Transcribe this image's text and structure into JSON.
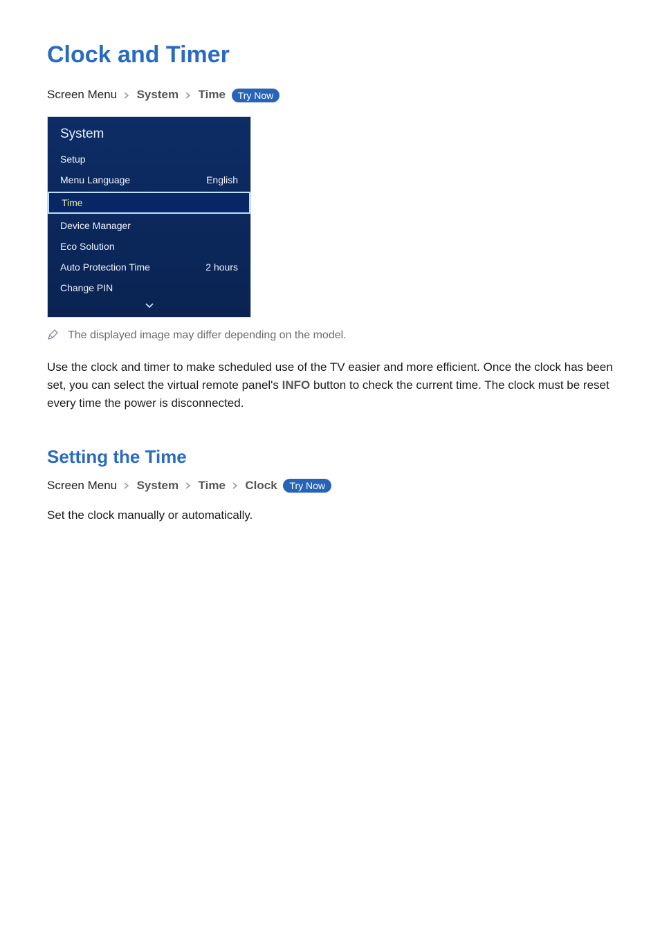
{
  "title": "Clock and Timer",
  "breadcrumb1": {
    "prefix": "Screen Menu",
    "items": [
      "System",
      "Time"
    ],
    "trynow": "Try Now"
  },
  "menu": {
    "header": "System",
    "rows": [
      {
        "label": "Setup",
        "value": ""
      },
      {
        "label": "Menu Language",
        "value": "English"
      }
    ],
    "selected": {
      "label": "Time",
      "value": ""
    },
    "rows_after": [
      {
        "label": "Device Manager",
        "value": ""
      },
      {
        "label": "Eco Solution",
        "value": ""
      },
      {
        "label": "Auto Protection Time",
        "value": "2 hours"
      },
      {
        "label": "Change PIN",
        "value": ""
      }
    ]
  },
  "note": "The displayed image may differ depending on the model.",
  "paragraph": {
    "pre": "Use the clock and timer to make scheduled use of the TV easier and more efficient. Once the clock has been set, you can select the virtual remote panel's ",
    "info": "INFO",
    "post": " button to check the current time. The clock must be reset every time the power is disconnected."
  },
  "subsection": {
    "title": "Setting the Time",
    "breadcrumb": {
      "prefix": "Screen Menu",
      "items": [
        "System",
        "Time",
        "Clock"
      ],
      "trynow": "Try Now"
    },
    "desc": "Set the clock manually or automatically."
  }
}
